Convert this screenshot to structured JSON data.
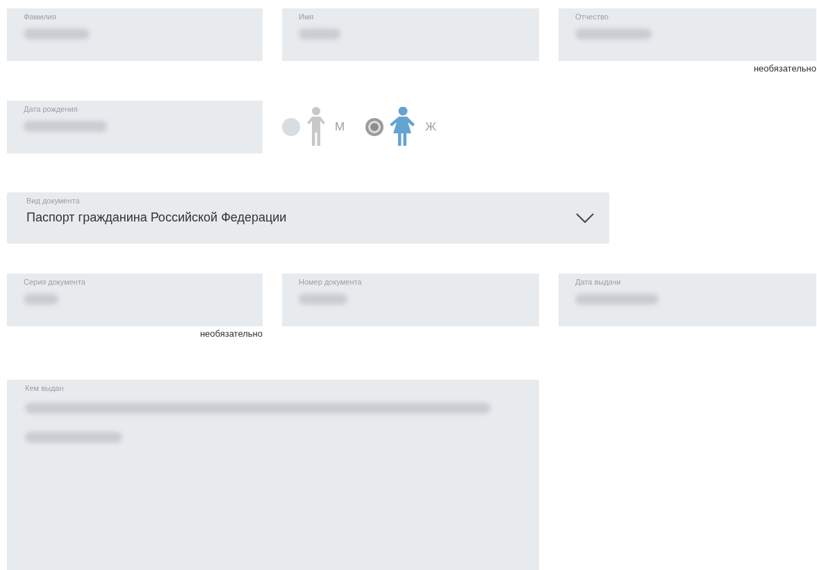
{
  "name_row": [
    {
      "label": "Фамилия",
      "redacted": true
    },
    {
      "label": "Имя",
      "redacted": true
    },
    {
      "label": "Отчество",
      "redacted": true,
      "note": "необязательно"
    }
  ],
  "birth_date": {
    "label": "Дата рождения",
    "redacted": true
  },
  "gender": [
    {
      "label": "М",
      "kind": "male",
      "selected": false
    },
    {
      "label": "Ж",
      "kind": "female",
      "selected": true
    }
  ],
  "document_type": {
    "label": "Вид документа",
    "value": "Паспорт гражданина Российской Федерации"
  },
  "document_row": [
    {
      "label": "Серия документа",
      "redacted": true,
      "note": "необязательно"
    },
    {
      "label": "Номер документа",
      "redacted": true
    },
    {
      "label": "Дата выдачи",
      "redacted": true
    }
  ],
  "issued_by": {
    "label": "Кем выдан",
    "redacted": true
  }
}
